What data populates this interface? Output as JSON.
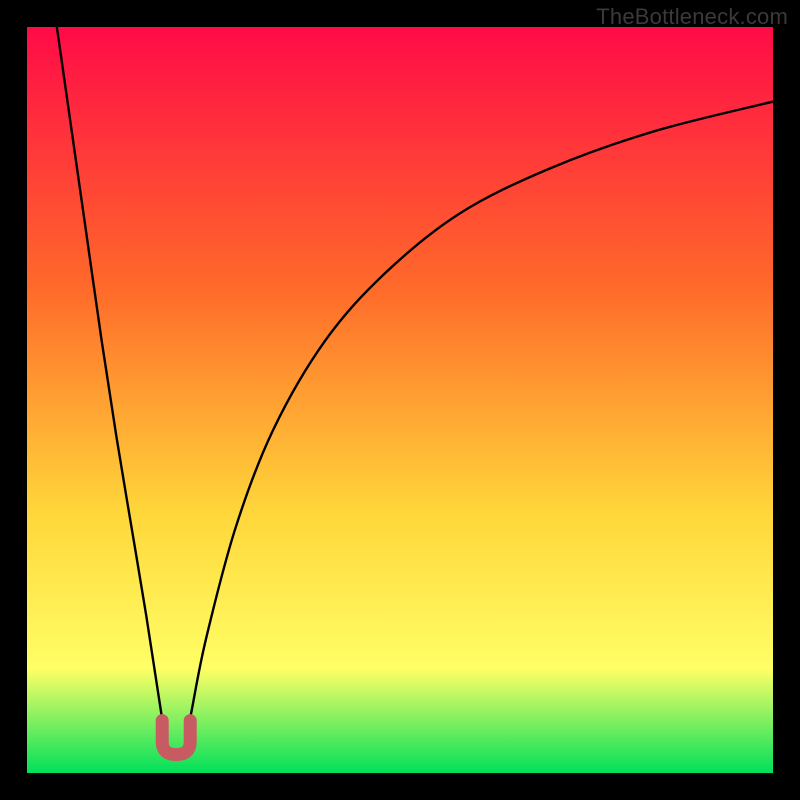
{
  "watermark": "TheBottleneck.com",
  "colors": {
    "frame": "#000000",
    "gradient_top": "#ff0b47",
    "gradient_mid1": "#ff6a2a",
    "gradient_mid2": "#ffd63a",
    "gradient_mid3": "#ffff66",
    "gradient_bottom": "#00e05a",
    "curve": "#000000",
    "marker": "#c85a62"
  },
  "chart_data": {
    "type": "line",
    "title": "",
    "xlabel": "",
    "ylabel": "",
    "xlim": [
      0,
      100
    ],
    "ylim": [
      0,
      100
    ],
    "series": [
      {
        "name": "bottleneck-curve",
        "x_optimum": 20,
        "y_at_optimum": 2,
        "points_xy": [
          [
            4,
            100
          ],
          [
            6,
            86
          ],
          [
            8,
            72
          ],
          [
            10,
            58
          ],
          [
            12,
            45
          ],
          [
            14,
            33
          ],
          [
            16,
            21
          ],
          [
            18,
            8
          ],
          [
            19,
            3
          ],
          [
            20,
            2
          ],
          [
            21,
            3
          ],
          [
            22,
            8
          ],
          [
            24,
            18
          ],
          [
            28,
            33
          ],
          [
            33,
            46
          ],
          [
            40,
            58
          ],
          [
            48,
            67
          ],
          [
            58,
            75
          ],
          [
            70,
            81
          ],
          [
            84,
            86
          ],
          [
            100,
            90
          ]
        ]
      }
    ],
    "marker": {
      "name": "optimum-u-marker",
      "x_center": 20,
      "y_center": 3,
      "shape": "U"
    }
  }
}
